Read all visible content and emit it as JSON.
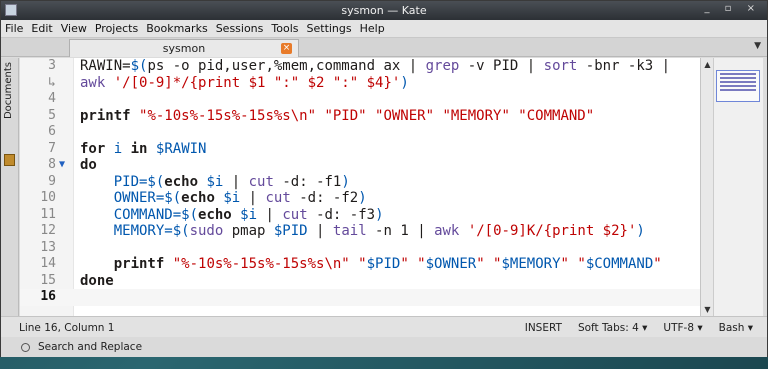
{
  "window": {
    "title": "sysmon — Kate",
    "controls": "_ ▫ ×"
  },
  "menu": [
    "File",
    "Edit",
    "View",
    "Projects",
    "Bookmarks",
    "Sessions",
    "Tools",
    "Settings",
    "Help"
  ],
  "tab": {
    "label": "sysmon",
    "close": "×"
  },
  "sidebar": {
    "label": "Documents"
  },
  "code_lines": [
    {
      "num": "3",
      "fold": "",
      "parts": [
        [
          "plain",
          "RAWIN="
        ],
        [
          "var",
          "$("
        ],
        [
          "plain",
          "ps -o pid,user,%mem,command ax "
        ],
        [
          "op",
          "|"
        ],
        [
          "plain",
          " "
        ],
        [
          "cmd",
          "grep"
        ],
        [
          "plain",
          " -v PID "
        ],
        [
          "op",
          "|"
        ],
        [
          "plain",
          " "
        ],
        [
          "cmd",
          "sort"
        ],
        [
          "plain",
          " -bnr -k3 "
        ],
        [
          "op",
          "|"
        ]
      ]
    },
    {
      "num": "↳",
      "fold": "",
      "parts": [
        [
          "cmd",
          "awk"
        ],
        [
          "plain",
          " "
        ],
        [
          "str",
          "'/[0-9]*/{print $1 \":\" $2 \":\" $4}'"
        ],
        [
          "var",
          ")"
        ]
      ]
    },
    {
      "num": "4",
      "fold": "",
      "parts": []
    },
    {
      "num": "5",
      "fold": "",
      "parts": [
        [
          "kw",
          "printf"
        ],
        [
          "plain",
          " "
        ],
        [
          "str",
          "\"%-10s%-15s%-15s%s\\n\" \"PID\" \"OWNER\" \"MEMORY\" \"COMMAND\""
        ]
      ]
    },
    {
      "num": "6",
      "fold": "",
      "parts": []
    },
    {
      "num": "7",
      "fold": "",
      "parts": [
        [
          "kw",
          "for"
        ],
        [
          "plain",
          " "
        ],
        [
          "var",
          "i"
        ],
        [
          "plain",
          " "
        ],
        [
          "kw",
          "in"
        ],
        [
          "plain",
          " "
        ],
        [
          "var",
          "$RAWIN"
        ]
      ]
    },
    {
      "num": "8",
      "fold": "▼",
      "parts": [
        [
          "kw",
          "do"
        ]
      ]
    },
    {
      "num": "9",
      "fold": "",
      "parts": [
        [
          "plain",
          "    "
        ],
        [
          "var",
          "PID=$("
        ],
        [
          "kw",
          "echo"
        ],
        [
          "plain",
          " "
        ],
        [
          "var",
          "$i"
        ],
        [
          "plain",
          " "
        ],
        [
          "op",
          "|"
        ],
        [
          "plain",
          " "
        ],
        [
          "cmd",
          "cut"
        ],
        [
          "plain",
          " -d: -f1"
        ],
        [
          "var",
          ")"
        ]
      ]
    },
    {
      "num": "10",
      "fold": "",
      "parts": [
        [
          "plain",
          "    "
        ],
        [
          "var",
          "OWNER=$("
        ],
        [
          "kw",
          "echo"
        ],
        [
          "plain",
          " "
        ],
        [
          "var",
          "$i"
        ],
        [
          "plain",
          " "
        ],
        [
          "op",
          "|"
        ],
        [
          "plain",
          " "
        ],
        [
          "cmd",
          "cut"
        ],
        [
          "plain",
          " -d: -f2"
        ],
        [
          "var",
          ")"
        ]
      ]
    },
    {
      "num": "11",
      "fold": "",
      "parts": [
        [
          "plain",
          "    "
        ],
        [
          "var",
          "COMMAND=$("
        ],
        [
          "kw",
          "echo"
        ],
        [
          "plain",
          " "
        ],
        [
          "var",
          "$i"
        ],
        [
          "plain",
          " "
        ],
        [
          "op",
          "|"
        ],
        [
          "plain",
          " "
        ],
        [
          "cmd",
          "cut"
        ],
        [
          "plain",
          " -d: -f3"
        ],
        [
          "var",
          ")"
        ]
      ]
    },
    {
      "num": "12",
      "fold": "",
      "parts": [
        [
          "plain",
          "    "
        ],
        [
          "var",
          "MEMORY=$("
        ],
        [
          "cmd",
          "sudo"
        ],
        [
          "plain",
          " pmap "
        ],
        [
          "var",
          "$PID"
        ],
        [
          "plain",
          " "
        ],
        [
          "op",
          "|"
        ],
        [
          "plain",
          " "
        ],
        [
          "cmd",
          "tail"
        ],
        [
          "plain",
          " -n 1 "
        ],
        [
          "op",
          "|"
        ],
        [
          "plain",
          " "
        ],
        [
          "cmd",
          "awk"
        ],
        [
          "plain",
          " "
        ],
        [
          "str",
          "'/[0-9]K/{print $2}'"
        ],
        [
          "var",
          ")"
        ]
      ]
    },
    {
      "num": "13",
      "fold": "",
      "parts": []
    },
    {
      "num": "14",
      "fold": "",
      "parts": [
        [
          "plain",
          "    "
        ],
        [
          "kw",
          "printf"
        ],
        [
          "plain",
          " "
        ],
        [
          "str",
          "\"%-10s%-15s%-15s%s\\n\" \""
        ],
        [
          "var",
          "$PID"
        ],
        [
          "str",
          "\" \""
        ],
        [
          "var",
          "$OWNER"
        ],
        [
          "str",
          "\" \""
        ],
        [
          "var",
          "$MEMORY"
        ],
        [
          "str",
          "\" \""
        ],
        [
          "var",
          "$COMMAND"
        ],
        [
          "str",
          "\""
        ]
      ]
    },
    {
      "num": "15",
      "fold": "",
      "parts": [
        [
          "kw",
          "done"
        ]
      ]
    },
    {
      "num": "16",
      "fold": "",
      "parts": [],
      "current": true
    }
  ],
  "status": {
    "position": "Line 16, Column 1",
    "mode": "INSERT",
    "tabs": "Soft Tabs: 4 ▾",
    "encoding": "UTF-8 ▾",
    "syntax": "Bash ▾"
  },
  "findbar": {
    "label": "Search and Replace"
  },
  "colors": {
    "keyword": "#1f1c1b",
    "string": "#bf0303",
    "variable": "#0057ae",
    "command": "#644a9b"
  }
}
